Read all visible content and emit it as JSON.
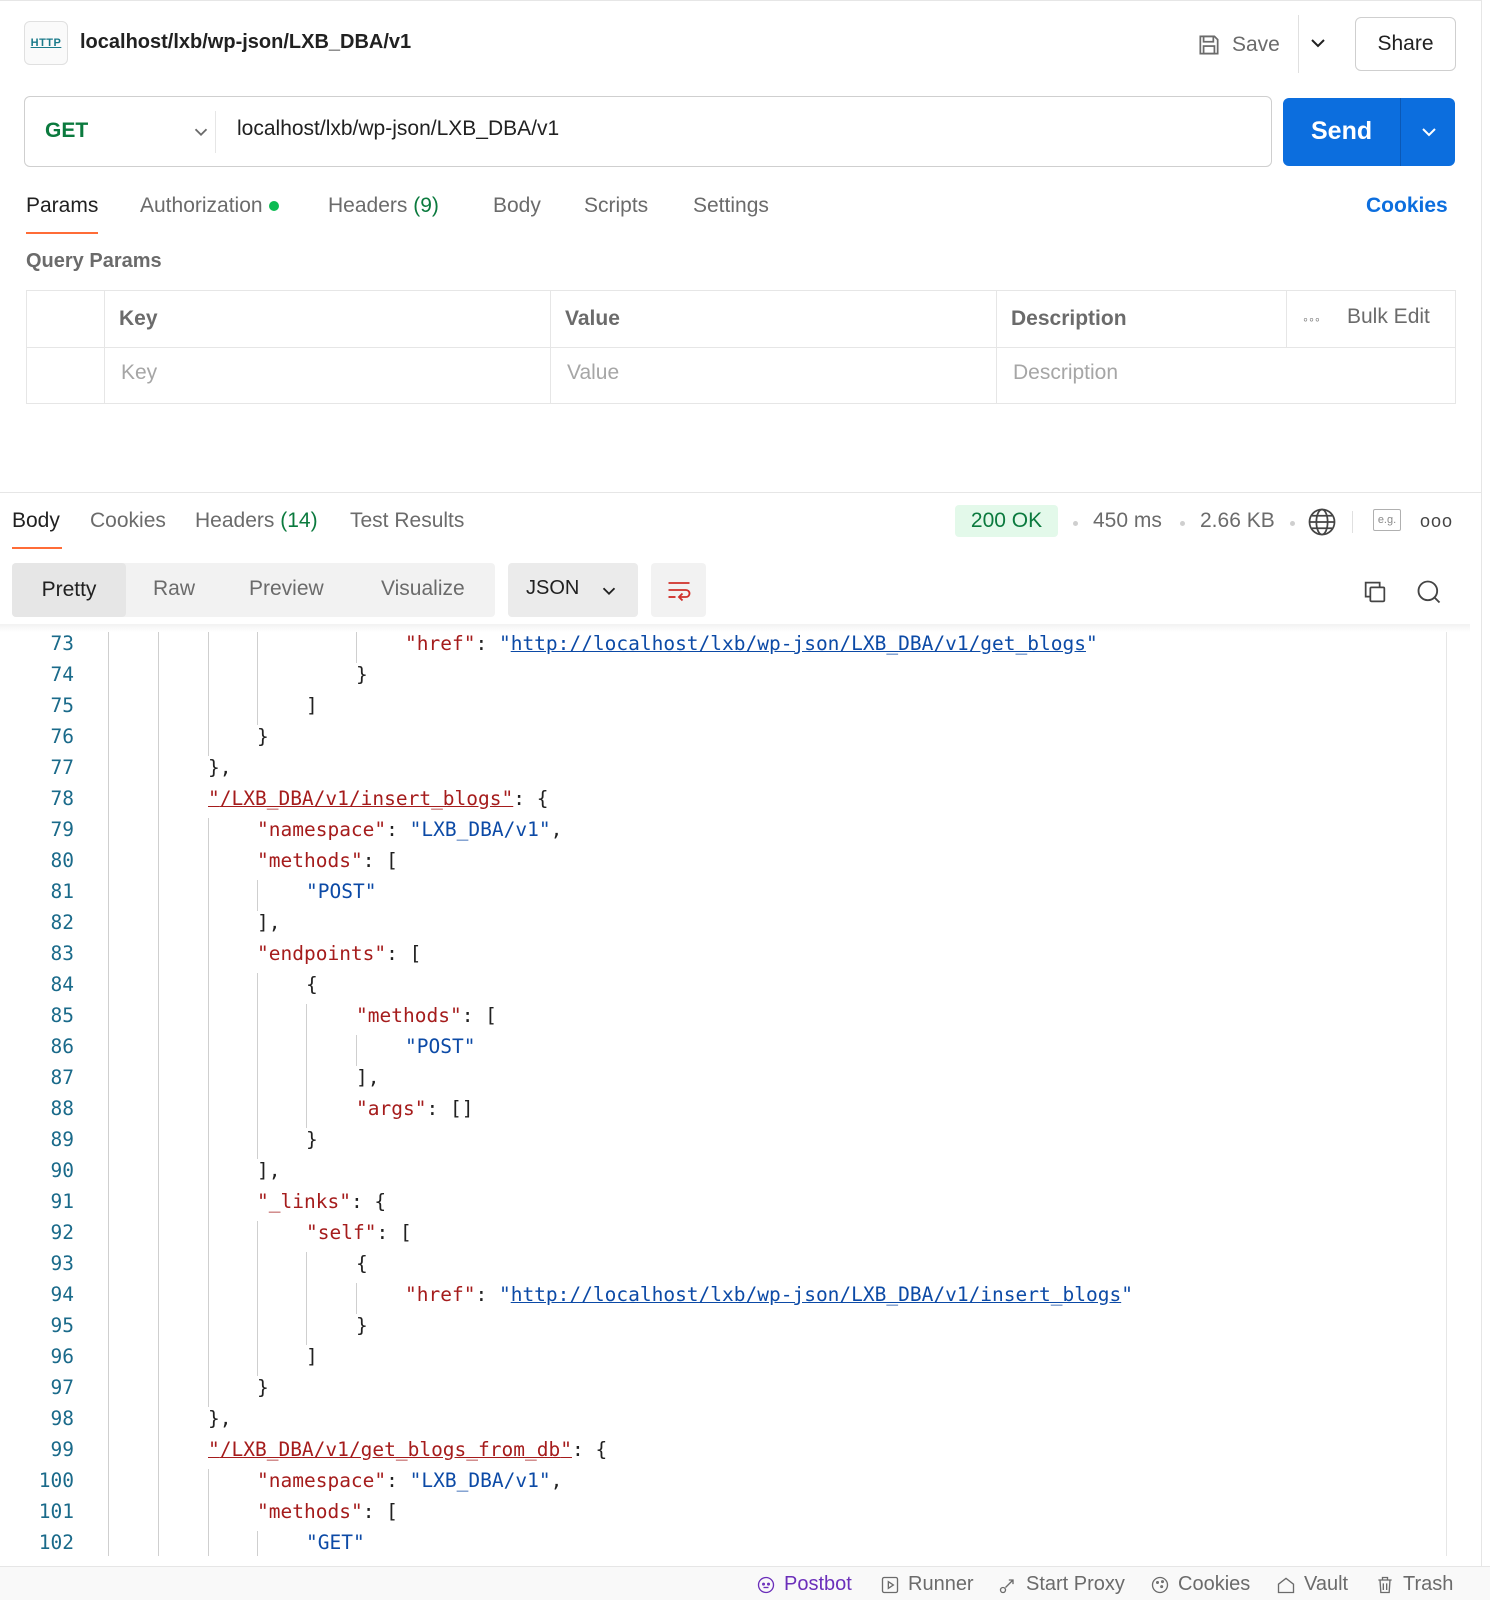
{
  "header": {
    "protocol_icon": "HTTP",
    "title": "localhost/lxb/wp-json/LXB_DBA/v1",
    "save_label": "Save",
    "share_label": "Share"
  },
  "request": {
    "method": "GET",
    "url": "localhost/lxb/wp-json/LXB_DBA/v1",
    "send_label": "Send"
  },
  "request_tabs": {
    "params": "Params",
    "authorization": "Authorization",
    "headers": "Headers",
    "headers_count": "(9)",
    "body": "Body",
    "scripts": "Scripts",
    "settings": "Settings",
    "cookies": "Cookies"
  },
  "query_params": {
    "title": "Query Params",
    "columns": [
      "Key",
      "Value",
      "Description"
    ],
    "placeholders": [
      "Key",
      "Value",
      "Description"
    ],
    "bulk_edit": "Bulk Edit"
  },
  "response_tabs": {
    "body": "Body",
    "cookies": "Cookies",
    "headers": "Headers",
    "headers_count": "(14)",
    "test_results": "Test Results"
  },
  "response_meta": {
    "status": "200 OK",
    "time": "450 ms",
    "size": "2.66 KB",
    "example_label": "e.g."
  },
  "view": {
    "options": [
      "Pretty",
      "Raw",
      "Preview",
      "Visualize"
    ],
    "format": "JSON"
  },
  "code_lines": [
    {
      "n": "73"
    },
    {
      "n": "74"
    },
    {
      "n": "75"
    },
    {
      "n": "76"
    },
    {
      "n": "77"
    },
    {
      "n": "78"
    },
    {
      "n": "79"
    },
    {
      "n": "80"
    },
    {
      "n": "81"
    },
    {
      "n": "82"
    },
    {
      "n": "83"
    },
    {
      "n": "84"
    },
    {
      "n": "85"
    },
    {
      "n": "86"
    },
    {
      "n": "87"
    },
    {
      "n": "88"
    },
    {
      "n": "89"
    },
    {
      "n": "90"
    },
    {
      "n": "91"
    },
    {
      "n": "92"
    },
    {
      "n": "93"
    },
    {
      "n": "94"
    },
    {
      "n": "95"
    },
    {
      "n": "96"
    },
    {
      "n": "97"
    },
    {
      "n": "98"
    },
    {
      "n": "99"
    },
    {
      "n": "100"
    },
    {
      "n": "101"
    },
    {
      "n": "102"
    }
  ],
  "code_text": {
    "href_key": "href",
    "get_blogs_url": "http://localhost/lxb/wp-json/LXB_DBA/v1/get_blogs",
    "insert_blogs_route": "/LXB_DBA/v1/insert_blogs",
    "namespace_key": "namespace",
    "namespace_val": "LXB_DBA/v1",
    "methods_key": "methods",
    "post_val": "POST",
    "endpoints_key": "endpoints",
    "args_key": "args",
    "links_key": "_links",
    "self_key": "self",
    "insert_blogs_url": "http://localhost/lxb/wp-json/LXB_DBA/v1/insert_blogs",
    "get_blogs_from_db_route": "/LXB_DBA/v1/get_blogs_from_db",
    "get_val": "GET"
  },
  "statusbar": {
    "postbot": "Postbot",
    "runner": "Runner",
    "start_proxy": "Start Proxy",
    "cookies": "Cookies",
    "vault": "Vault",
    "trash": "Trash"
  },
  "colors": {
    "accent": "#ff6c37",
    "send": "#0c6ede",
    "get": "#0b7a3e",
    "json_key": "#a51c1c",
    "json_string": "#0c4aa6"
  }
}
